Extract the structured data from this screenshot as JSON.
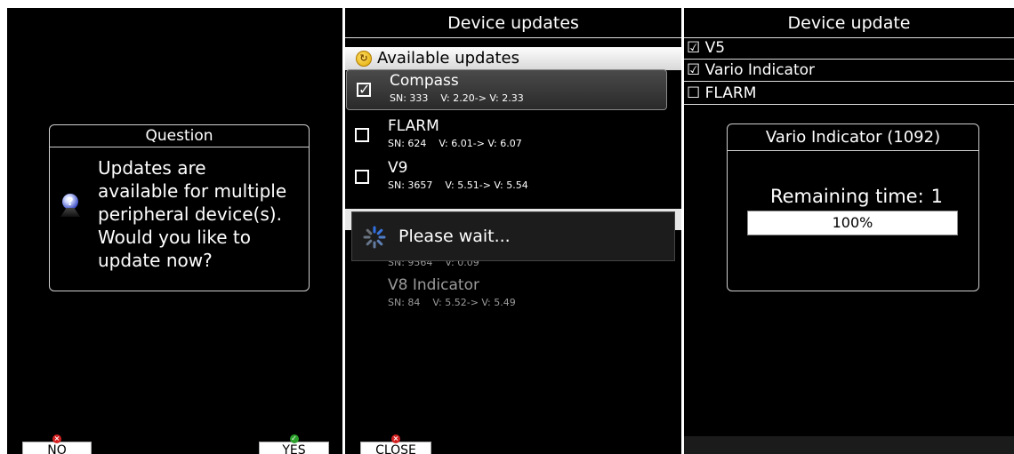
{
  "panel1": {
    "dialog": {
      "title": "Question",
      "message_lines": [
        "Updates are",
        "available for multiple",
        "peripheral device(s).",
        "Would you like to",
        "update now?"
      ]
    },
    "softkeys": {
      "no": "NO",
      "yes": "YES"
    }
  },
  "panel2": {
    "title": "Device updates",
    "section": "Available updates",
    "devices": [
      {
        "name": "Compass",
        "sn": "SN: 333",
        "version": "V: 2.20-> V: 2.33",
        "checked": true
      },
      {
        "name": "FLARM",
        "sn": "SN: 624",
        "version": "V: 6.01-> V: 6.07",
        "checked": false
      },
      {
        "name": "V9",
        "sn": "SN: 3657",
        "version": "V: 5.51-> V: 5.54",
        "checked": false
      },
      {
        "name": "",
        "sn": "SN: 9564",
        "version": "V: 0.09",
        "checked": false
      },
      {
        "name": "V8 Indicator",
        "sn": "SN: 84",
        "version": "V: 5.52-> V: 5.49",
        "checked": false
      }
    ],
    "wait_text": "Please wait...",
    "softkeys": {
      "close": "CLOSE"
    }
  },
  "panel3": {
    "title": "Device update",
    "items": [
      {
        "label": "V5",
        "checked": true
      },
      {
        "label": "Vario Indicator",
        "checked": true
      },
      {
        "label": "FLARM",
        "checked": false
      }
    ],
    "progress_dialog": {
      "title": "Vario Indicator (1092)",
      "remaining_label": "Remaining time:",
      "remaining_value": "1",
      "progress_text": "100%",
      "progress_fraction": 1.0
    }
  },
  "icons": {
    "question": "question-icon",
    "refresh": "refresh-icon",
    "spinner": "spinner-icon",
    "checkbox_checked": "☑",
    "checkbox_unchecked": "☐"
  },
  "colors": {
    "background": "#000000",
    "accent_highlight": "#3a3a3a"
  }
}
